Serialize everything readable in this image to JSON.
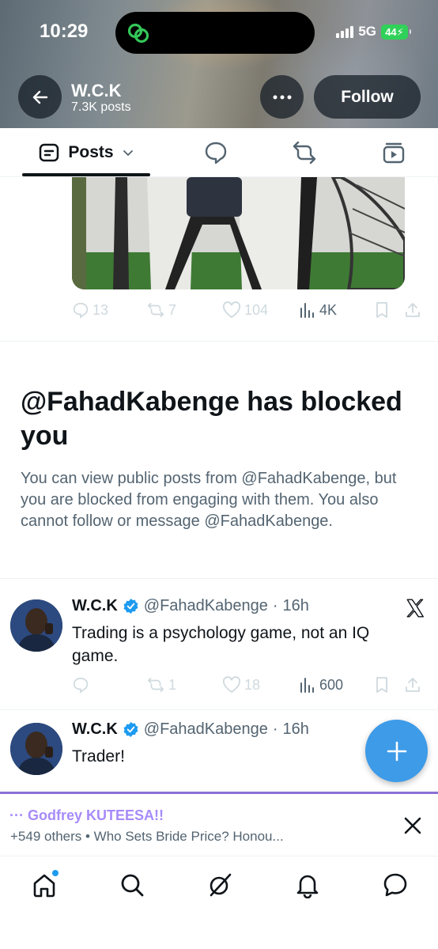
{
  "status_bar": {
    "time": "10:29",
    "network": "5G",
    "battery": "44"
  },
  "header": {
    "name": "W.C.K",
    "posts_count": "7.3K posts",
    "follow_label": "Follow"
  },
  "tabs": {
    "posts_label": "Posts"
  },
  "media_post": {
    "replies": "13",
    "reposts": "7",
    "likes": "104",
    "views": "4K"
  },
  "blocked": {
    "title": "@FahadKabenge has blocked you",
    "body": "You can view public posts from @FahadKabenge, but you are blocked from engaging with them. You also cannot follow or message @FahadKabenge."
  },
  "posts": [
    {
      "name": "W.C.K",
      "handle": "@FahadKabenge",
      "time": "16h",
      "text": "Trading is a psychology game, not an IQ game.",
      "replies": "",
      "reposts": "1",
      "likes": "18",
      "views": "600"
    },
    {
      "name": "W.C.K",
      "handle": "@FahadKabenge",
      "time": "16h",
      "text": "Trader!"
    }
  ],
  "space": {
    "host": "Godfrey KUTEESA!!",
    "subtitle": "+549 others • Who Sets Bride Price? Honou..."
  },
  "colors": {
    "accent": "#1d9bf0",
    "fab": "#3e9be8",
    "space": "#8b6fd6",
    "verified": "#1d9bf0"
  }
}
